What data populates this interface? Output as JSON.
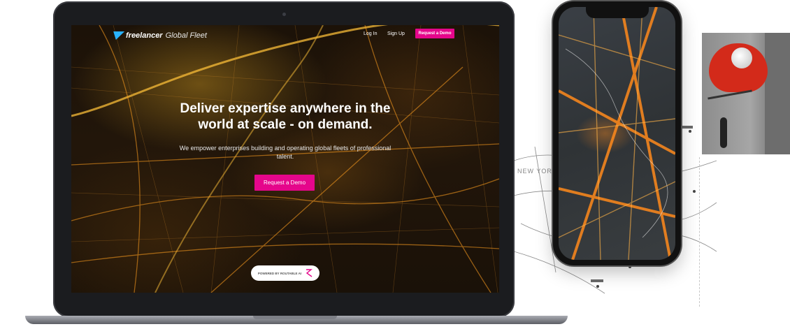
{
  "site": {
    "brand": "freelancer",
    "product": "Global Fleet",
    "nav": {
      "login": "Log In",
      "signup": "Sign Up",
      "demo": "Request a Demo"
    },
    "hero": {
      "title": "Deliver expertise anywhere in the world at scale - on demand.",
      "subtitle": "We empower enterprises building and operating global fleets of professional talent.",
      "cta": "Request a Demo"
    },
    "powered_by": "POWERED BY ROUTABLE AI"
  },
  "map": {
    "city_label": "NEW YORK"
  },
  "colors": {
    "accent": "#e5068b",
    "brand_blue": "#29b2fe",
    "glow": "#ffb020"
  }
}
